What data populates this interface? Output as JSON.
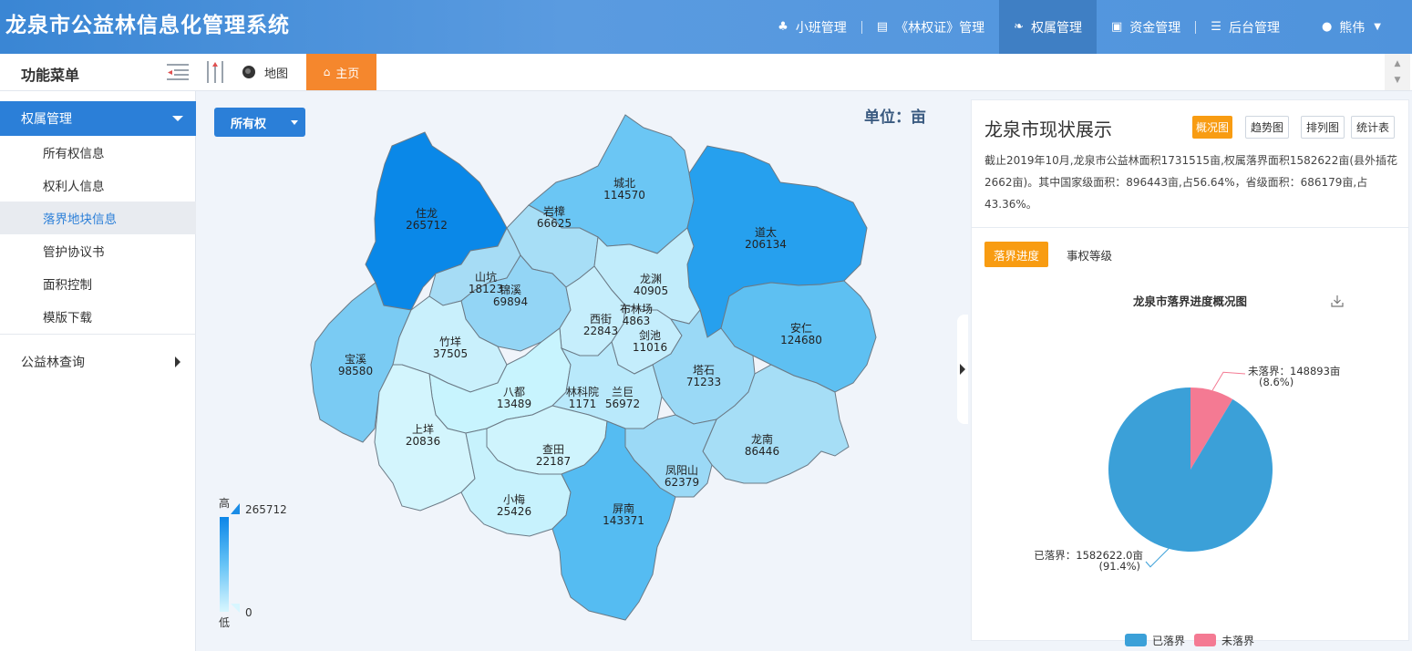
{
  "header": {
    "app_title": "龙泉市公益林信息化管理系统",
    "nav": [
      {
        "label": "小班管理",
        "icon": "tree-icon"
      },
      {
        "label": "《林权证》管理",
        "icon": "book-icon"
      },
      {
        "label": "权属管理",
        "icon": "leaf-icon",
        "active": true
      },
      {
        "label": "资金管理",
        "icon": "money-icon"
      },
      {
        "label": "后台管理",
        "icon": "list-icon"
      }
    ],
    "user_name": "熊伟"
  },
  "toolbar": {
    "menu_title": "功能菜单",
    "map_tab": "地图",
    "home_tab": "主页"
  },
  "sidebar": {
    "group_label": "权属管理",
    "items": [
      {
        "label": "所有权信息"
      },
      {
        "label": "权利人信息"
      },
      {
        "label": "落界地块信息",
        "active": true
      },
      {
        "label": "管护协议书"
      },
      {
        "label": "面积控制"
      },
      {
        "label": "模版下载"
      }
    ],
    "query_label": "公益林查询"
  },
  "map": {
    "ownership_select": "所有权",
    "unit_label": "单位：亩",
    "legend": {
      "high": "高",
      "low": "低",
      "max": "265712",
      "min": "0"
    },
    "regions": [
      {
        "name": "住龙",
        "value": "265712"
      },
      {
        "name": "城北",
        "value": "114570"
      },
      {
        "name": "岩樟",
        "value": "66625"
      },
      {
        "name": "道太",
        "value": "206134"
      },
      {
        "name": "山坑",
        "value": "18123"
      },
      {
        "name": "锦溪",
        "value": "69894"
      },
      {
        "name": "龙渊",
        "value": "40905"
      },
      {
        "name": "布林场",
        "value": "4863"
      },
      {
        "name": "西街",
        "value": "22843"
      },
      {
        "name": "剑池",
        "value": "11016"
      },
      {
        "name": "安仁",
        "value": "124680"
      },
      {
        "name": "宝溪",
        "value": "98580"
      },
      {
        "name": "竹垟",
        "value": "37505"
      },
      {
        "name": "塔石",
        "value": "71233"
      },
      {
        "name": "八都",
        "value": "13489"
      },
      {
        "name": "林科院",
        "value": "1171"
      },
      {
        "name": "兰巨",
        "value": "56972"
      },
      {
        "name": "上垟",
        "value": "20836"
      },
      {
        "name": "龙南",
        "value": "86446"
      },
      {
        "name": "查田",
        "value": "22187"
      },
      {
        "name": "凤阳山",
        "value": "62379"
      },
      {
        "name": "小梅",
        "value": "25426"
      },
      {
        "name": "屏南",
        "value": "143371"
      }
    ]
  },
  "panel": {
    "title": "龙泉市现状展示",
    "buttons": [
      "概况图",
      "趋势图",
      "排列图",
      "统计表"
    ],
    "description": "截止2019年10月,龙泉市公益林面积1731515亩,权属落界面积1582622亩(县外插花2662亩)。其中国家级面积：896443亩,占56.64%，省级面积：686179亩,占43.36%。",
    "tabs": [
      "落界进度",
      "事权等级"
    ]
  },
  "chart_data": {
    "type": "pie",
    "title": "龙泉市落界进度概况图",
    "series": [
      {
        "name": "已落界",
        "value": 1582622.0,
        "percent": 91.4,
        "label": "已落界：1582622.0亩",
        "pct_label": "(91.4%)",
        "color": "#3ba0d8"
      },
      {
        "name": "未落界",
        "value": 148893,
        "percent": 8.6,
        "label": "未落界：148893亩",
        "pct_label": "(8.6%)",
        "color": "#f47a93"
      }
    ],
    "legend": [
      "已落界",
      "未落界"
    ],
    "legend_position": "bottom"
  }
}
